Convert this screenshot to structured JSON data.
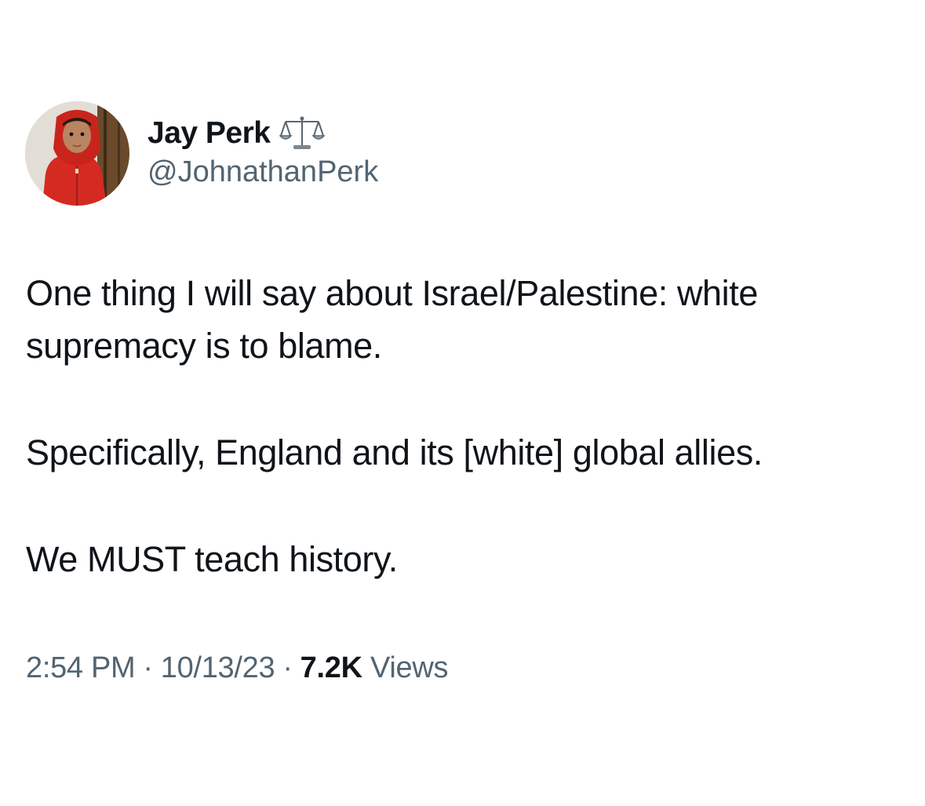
{
  "author": {
    "display_name": "Jay Perk",
    "badge_icon": "scales-icon",
    "handle": "@JohnathanPerk",
    "avatar_icon": "avatar-photo"
  },
  "tweet": {
    "paragraphs": [
      "One thing I will say about Israel/Palestine: white supremacy is to blame.",
      "Specifically, England and its [white] global allies.",
      "We MUST teach history."
    ]
  },
  "meta": {
    "time": "2:54 PM",
    "separator": "·",
    "date": "10/13/23",
    "views_count": "7.2K",
    "views_label": "Views"
  },
  "colors": {
    "text_primary": "#0f1419",
    "text_secondary": "#536471",
    "avatar_hoodie": "#d42a22"
  }
}
